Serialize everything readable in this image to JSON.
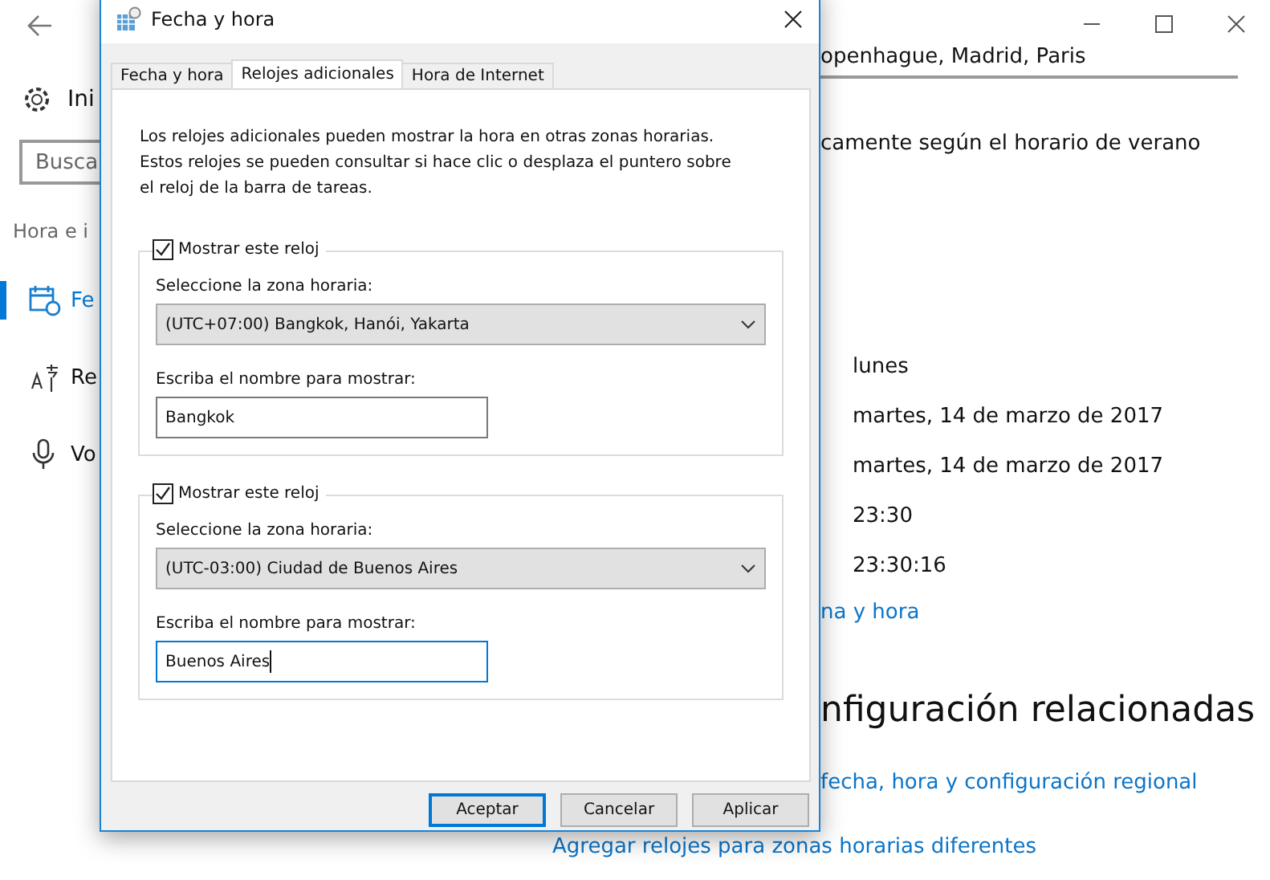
{
  "sidebar": {
    "home_label": "Ini",
    "search": {
      "placeholder": "Busca"
    },
    "section_label": "Hora e i",
    "items": [
      {
        "label": "Fe",
        "kind": "calendar",
        "selected": true
      },
      {
        "label": "Re",
        "kind": "language",
        "selected": false
      },
      {
        "label": "Vo",
        "kind": "microphone",
        "selected": false
      }
    ]
  },
  "content": {
    "time_zone_value": "openhague, Madrid, Paris",
    "dst_text": "camente según el horario de verano",
    "format_values": [
      "lunes",
      "martes, 14 de marzo de 2017",
      "martes, 14 de marzo de 2017",
      "23:30",
      "23:30:16"
    ],
    "change_link": "na y hora",
    "related_heading": "nfiguración relacionadas",
    "related_links": [
      "fecha, hora y configuración regional",
      "Agregar relojes para zonas horarias diferentes"
    ]
  },
  "dialog": {
    "title": "Fecha y hora",
    "tabs": [
      {
        "label": "Fecha y hora",
        "selected": false
      },
      {
        "label": "Relojes adicionales",
        "selected": true
      },
      {
        "label": "Hora de Internet",
        "selected": false
      }
    ],
    "description": "Los relojes adicionales pueden mostrar la hora en otras zonas horarias. Estos relojes se pueden consultar si hace clic o desplaza el puntero sobre el reloj de la barra de tareas.",
    "clocks": [
      {
        "show_label": "Mostrar este reloj",
        "checked": true,
        "zone_label": "Seleccione la zona horaria:",
        "zone": "(UTC+07:00) Bangkok, Hanói, Yakarta",
        "name_label": "Escriba el nombre para mostrar:",
        "name": "Bangkok",
        "focused": false
      },
      {
        "show_label": "Mostrar este reloj",
        "checked": true,
        "zone_label": "Seleccione la zona horaria:",
        "zone": "(UTC-03:00) Ciudad de Buenos Aires",
        "name_label": "Escriba el nombre para mostrar:",
        "name": "Buenos Aires",
        "focused": true
      }
    ],
    "buttons": [
      {
        "label": "Aceptar",
        "default": true
      },
      {
        "label": "Cancelar",
        "default": false
      },
      {
        "label": "Aplicar",
        "default": false
      }
    ]
  }
}
